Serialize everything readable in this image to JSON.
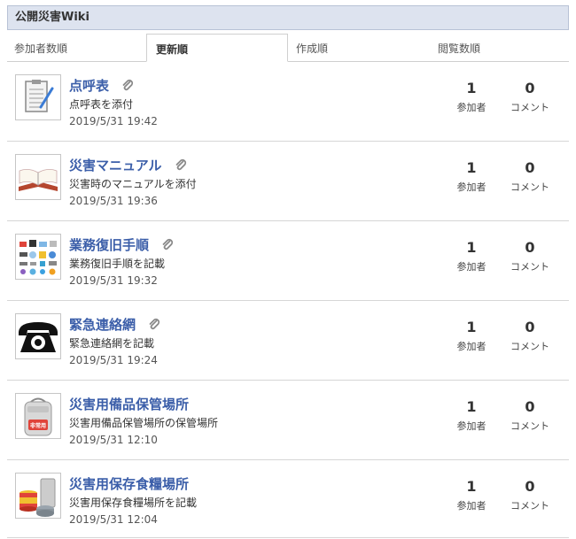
{
  "header": {
    "title": "公開災害Wiki"
  },
  "tabs": [
    {
      "label": "参加者数順"
    },
    {
      "label": "更新順"
    },
    {
      "label": "作成順"
    },
    {
      "label": "閲覧数順"
    }
  ],
  "active_tab": "更新順",
  "stat_labels": {
    "participants": "参加者",
    "comments": "コメント"
  },
  "items": [
    {
      "title": "点呼表",
      "description": "点呼表を添付",
      "date": "2019/5/31 19:42",
      "participants": "1",
      "comments": "0",
      "attachment": true,
      "icon": "checklist-icon"
    },
    {
      "title": "災害マニュアル",
      "description": "災害時のマニュアルを添付",
      "date": "2019/5/31 19:36",
      "participants": "1",
      "comments": "0",
      "attachment": true,
      "icon": "open-book-icon"
    },
    {
      "title": "業務復旧手順",
      "description": "業務復旧手順を記載",
      "date": "2019/5/31 19:32",
      "participants": "1",
      "comments": "0",
      "attachment": true,
      "icon": "office-items-icon"
    },
    {
      "title": "緊急連絡網",
      "description": "緊急連絡網を記載",
      "date": "2019/5/31 19:24",
      "participants": "1",
      "comments": "0",
      "attachment": true,
      "icon": "telephone-icon"
    },
    {
      "title": "災害用備品保管場所",
      "description": "災害用備品保管場所の保管場所",
      "date": "2019/5/31 12:10",
      "participants": "1",
      "comments": "0",
      "attachment": false,
      "icon": "emergency-backpack-icon",
      "thumb_text": "非常用"
    },
    {
      "title": "災害用保存食糧場所",
      "description": "災害用保存食糧場所を記載",
      "date": "2019/5/31 12:04",
      "participants": "1",
      "comments": "0",
      "attachment": false,
      "icon": "canned-food-icon"
    }
  ],
  "colors": {
    "title_link": "#3b5ea9",
    "header_bg": "#dde3ef"
  }
}
